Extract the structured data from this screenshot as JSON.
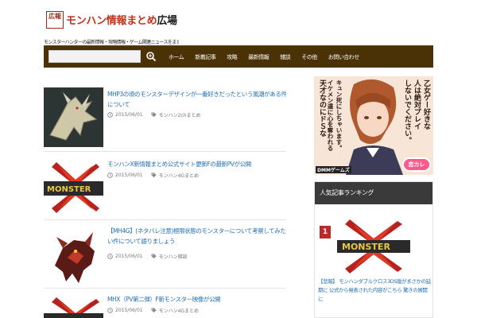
{
  "header": {
    "logo_stamp": "広報",
    "logo_main": "モンハン情報まとめ",
    "logo_place": "広場",
    "tagline": "モンスターハンターの最新情報・攻略情報・ゲーム関連ニュースをまとめてお届けします"
  },
  "nav": {
    "search_placeholder": "",
    "items": [
      "ホーム",
      "新着記事",
      "攻略",
      "最新情報",
      "雑談",
      "その他",
      "お問い合わせ"
    ]
  },
  "posts": [
    {
      "title": "MHP3の頃のモンスターデザインが一番好きだったという風潮がある件について",
      "date": "2015/06/01",
      "tag": "モンハン2chまとめ"
    },
    {
      "title": "モンハンX新情報まとめ公式サイト更新Fの最新PVが公開",
      "date": "2015/06/01",
      "tag": "モンハン4Gまとめ"
    },
    {
      "title": "【MH4G】(ネタバレ注意)極限状態のモンスターについて考察してみたい件について語りましょう",
      "date": "2015/06/01",
      "tag": "モンハン雑談"
    },
    {
      "title": "MHX（PV第二弾）F新モンスター映像が公開",
      "date": "2015/06/01",
      "tag": "モンハン4Gまとめ"
    }
  ],
  "ad": {
    "lines": [
      "乙女ゲー好きな",
      "人は絶対プレイ",
      "しないでください。",
      "天才なのにドＳな",
      "イケメン達に心を奪われる",
      "キュン死にしちゃいます。"
    ],
    "brand": "DMMゲームズ",
    "badge": "恋カレ"
  },
  "widget": {
    "title": "人気記事ランキング",
    "rank": "1",
    "item_text": "【悲報】 モンハンダブルクロス3DS版がまさかの延期に 公式から発表された内容がこちら 驚きの展開に"
  },
  "colors": {
    "nav_bg": "#4a3206",
    "link": "#1f6fb7",
    "logo_red": "#c4321a",
    "rank_red": "#b82c2c",
    "widget_head": "#3a3a3a"
  }
}
